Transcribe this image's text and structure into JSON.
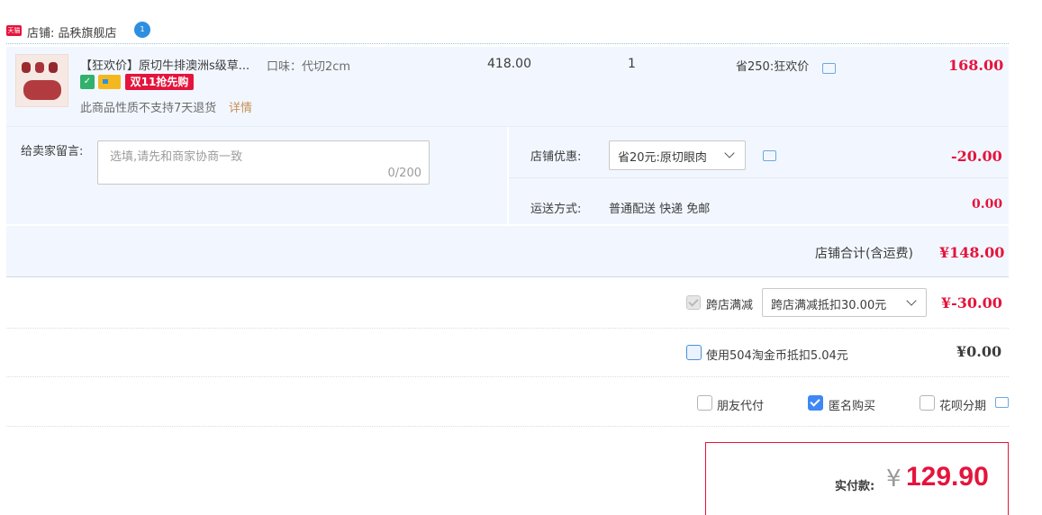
{
  "shop": {
    "badge_label": "天猫",
    "label": "店铺: 品秩旗舰店",
    "chat_badge": "1"
  },
  "item": {
    "title": "【狂欢价】原切牛排澳洲s级草...",
    "flavor": "口味：代切2cm",
    "double11_label": "双11抢先购",
    "note": "此商品性质不支持7天退货",
    "note_link": "详情",
    "unit_price": "418.00",
    "quantity": "1",
    "discount": "省250:狂欢价",
    "subtotal": "168.00"
  },
  "message": {
    "label": "给卖家留言:",
    "placeholder": "选填,请先和商家协商一致",
    "count": "0/200"
  },
  "shop_promo": {
    "label": "店铺优惠:",
    "selected": "省20元:原切眼肉",
    "value": "-20.00"
  },
  "shipping": {
    "label": "运送方式:",
    "value": "普通配送 快递 免邮",
    "fee": "0.00"
  },
  "shop_total": {
    "label": "店铺合计(含运费)",
    "value": "¥148.00"
  },
  "cross_store": {
    "label": "跨店满减",
    "checked": true,
    "selected": "跨店满减抵扣30.00元",
    "value": "¥-30.00"
  },
  "taojinbi": {
    "label": "使用504淘金币抵扣5.04元",
    "value": "¥0.00"
  },
  "options": {
    "friend_pay": "朋友代付",
    "anonymous": "匿名购买",
    "huabei": "花呗分期"
  },
  "payment": {
    "label": "实付款:",
    "currency": "¥",
    "value": "129.90"
  },
  "colors": {
    "accent": "#e5143c",
    "link_blue": "#3f87f5",
    "row_bg": "#f2f7ff"
  }
}
